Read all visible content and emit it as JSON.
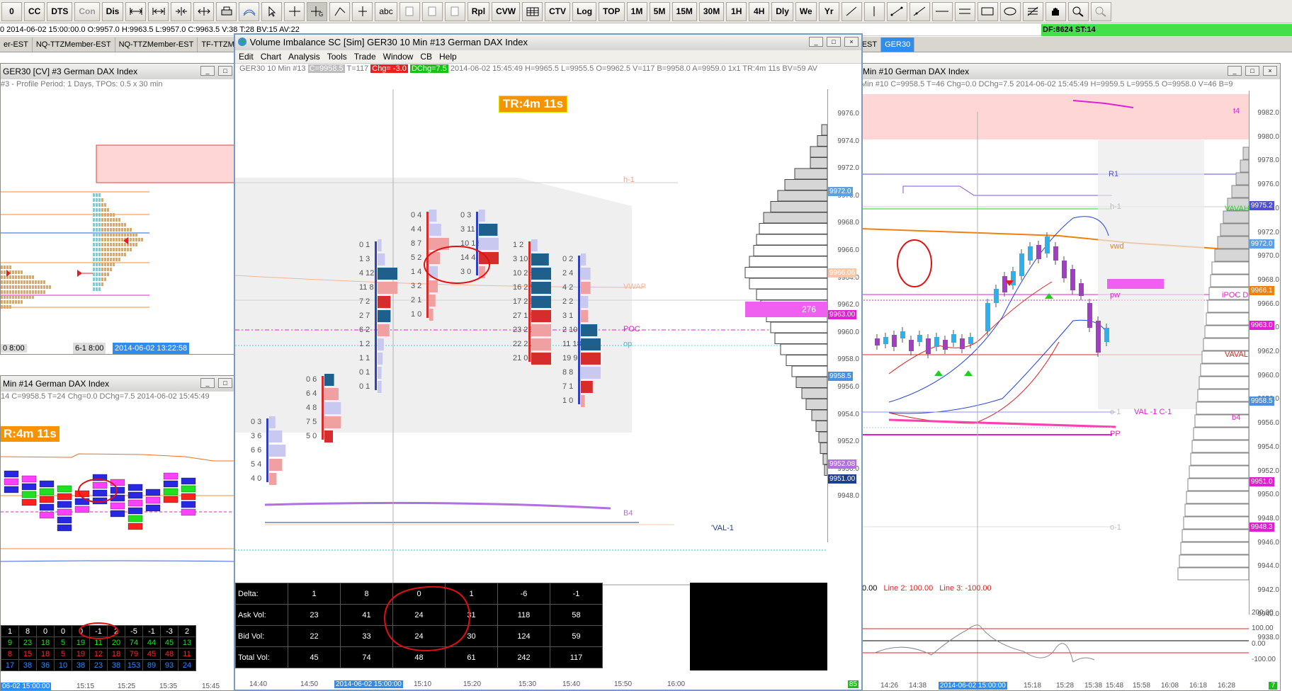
{
  "toolbar": {
    "buttons": [
      "CC",
      "DTS",
      "Con",
      "Dis",
      "Rpl",
      "CVW",
      "CTV",
      "Log",
      "TOP",
      "1M",
      "5M",
      "15M",
      "30M",
      "1H",
      "4H",
      "Dly",
      "We",
      "Yr"
    ]
  },
  "status": {
    "ohlc": "0  2014-06-02 15:00:00.0  O:9957.0  H:9963.5  L:9957.0  C:9963.5  V:38  T:28  BV:15  AV:22",
    "df": "DF:8624  ST:14"
  },
  "tabs": [
    "er-EST",
    "NQ-TTZMember-EST",
    "NQ-TTZMember-EST",
    "TF-TTZMember-EST",
    "mber-EST",
    "GER30"
  ],
  "left_top": {
    "title": "GER30 [CV]  #3  German DAX Index",
    "info": "#3 - Profile Period: 1 Days, TPOs: 0.5 x 30 min",
    "date1": "0 8:00",
    "date2": "6-1 8:00",
    "date3": "2014-06-02 13:22:58"
  },
  "left_bottom": {
    "title": "Min  #14  German DAX Index",
    "info": "14  C=9958.5  T=24  Chg=0.0  DChg=7.5  2014-06-02 15:45:49",
    "banner": "R:4m 11s",
    "rows": [
      [
        "1",
        "8",
        "0",
        "0",
        "0",
        "-1",
        "2",
        "-5",
        "-1",
        "-3",
        "2"
      ],
      [
        "9",
        "23",
        "18",
        "5",
        "19",
        "11",
        "20",
        "74",
        "44",
        "45",
        "13"
      ],
      [
        "8",
        "15",
        "18",
        "5",
        "19",
        "12",
        "18",
        "79",
        "45",
        "48",
        "11"
      ],
      [
        "17",
        "38",
        "36",
        "10",
        "38",
        "23",
        "38",
        "153",
        "89",
        "93",
        "24"
      ]
    ],
    "times": [
      "06-02 15:00:00",
      "15:15",
      "15:25",
      "15:35",
      "15:45"
    ]
  },
  "main": {
    "title": "Volume Imbalance  SC [Sim] GER30  10 Min   #13  German DAX Index",
    "menu": [
      "Edit",
      "Chart",
      "Analysis",
      "Tools",
      "Trade",
      "Window",
      "CB",
      "Help"
    ],
    "info_sym": "GER30  10 Min  #13",
    "info_c": "C=9958.5",
    "info_t": "T=117",
    "info_chg": "Chg= -3.0",
    "info_dchg": "DChg=7.5",
    "info_rest": "2014-06-02 15:45:49  H=9965.5  L=9955.5  O=9962.5  V=117  B=9958.0  A=9959.0  1x1  TR:4m 11s  BV=59  AV",
    "timer": "TR:4m 11s",
    "labels": {
      "h1": "h-1",
      "vwap": "VWAP",
      "poc": "POC",
      "op": "op",
      "b4": "B4",
      "val1": "'VAL-1"
    },
    "profile_poc": "276",
    "y_ticks": [
      "9976.0",
      "9974.0",
      "9972.0",
      "9970.0",
      "9968.0",
      "9966.0",
      "9964.0",
      "9962.0",
      "9960.0",
      "9958.0",
      "9956.0",
      "9954.0",
      "9952.0",
      "9950.0",
      "9948.0"
    ],
    "price_tags": [
      {
        "label": "9972.0",
        "color": "#5aa0e8"
      },
      {
        "label": "9966.06",
        "color": "#f5c9a8"
      },
      {
        "label": "9963.00",
        "color": "#e020d0"
      },
      {
        "label": "9958.5",
        "color": "#4a90e0"
      },
      {
        "label": "9952.08",
        "color": "#b070e0"
      },
      {
        "label": "9951.00",
        "color": "#1f3f8c"
      }
    ],
    "delta_table": {
      "labels": [
        "Delta:",
        "Ask Vol:",
        "Bid Vol:",
        "Total Vol:"
      ],
      "delta": [
        "1",
        "8",
        "0",
        "1",
        "-6",
        "-1"
      ],
      "ask": [
        "23",
        "41",
        "24",
        "31",
        "118",
        "58"
      ],
      "bid": [
        "22",
        "33",
        "24",
        "30",
        "124",
        "59"
      ],
      "total": [
        "45",
        "74",
        "48",
        "61",
        "242",
        "117"
      ]
    },
    "x_labels": [
      "14:40",
      "14:50",
      "2014-06-02 15:00:00",
      "15:10",
      "15:20",
      "15:30",
      "15:40",
      "15:50",
      "16:00"
    ],
    "footprint": [
      [
        "0 3",
        "3 6",
        "6 6",
        "5 4",
        "4 0"
      ],
      [
        "0 6",
        "6 4",
        "4 8",
        "7 5",
        "5 0"
      ],
      [
        "0 1",
        "1 3",
        "4 12",
        "11 8",
        "7 2",
        "2 7",
        "6 2",
        "1 2",
        "1 1",
        "0 1",
        "0 1"
      ],
      [
        "0 4",
        "4 4",
        "8 7",
        "5 2",
        "1 4",
        "3 2",
        "2 1",
        "1 0"
      ],
      [
        "0 3",
        "3 11",
        "10 13",
        "14 4",
        "3 0"
      ],
      [
        "1 2",
        "3 10",
        "10 25",
        "16 27",
        "17 22",
        "27 16",
        "23 22",
        "22 21",
        "21 0"
      ],
      [
        "0 2",
        "2 4",
        "4 2",
        "2 2",
        "3 1",
        "2 10",
        "11 18",
        "19 9",
        "8 8",
        "7 1",
        "1 0"
      ]
    ]
  },
  "right": {
    "title": "Min  #10  German DAX Index",
    "info": "Min  #10  C=9958.5  T=46  Chg=0.0  DChg=7.5  2014-06-02 15:45:49  H=9959.5  L=9955.5  O=9958.0  V=46  B=9",
    "labels": {
      "r1": "R1",
      "h1": "h-1",
      "vah": "VAVAH",
      "vwd": "vwd",
      "poc_d": "iPOC D",
      "pw": "pw",
      "val": "VAVAL",
      "c1": "c-1",
      "val1": "VAL -1  C-1",
      "b4": "b4",
      "pp": "PP",
      "o1": "o-1",
      "t4": "t4"
    },
    "y_ticks": [
      "9982.0",
      "9980.0",
      "9978.0",
      "9976.0",
      "9974.0",
      "9972.0",
      "9970.0",
      "9968.0",
      "9966.0",
      "9964.0",
      "9962.0",
      "9960.0",
      "9958.0",
      "9956.0",
      "9954.0",
      "9952.0",
      "9950.0",
      "9948.0",
      "9946.0",
      "9944.0",
      "9942.0",
      "9940.0",
      "9938.0"
    ],
    "price_tags": [
      {
        "label": "9975.2",
        "color": "#5050d0"
      },
      {
        "label": "9972.0",
        "color": "#5aa0e8"
      },
      {
        "label": "9966.1",
        "color": "#f08010"
      },
      {
        "label": "9963.0",
        "color": "#e020d0"
      },
      {
        "label": "9958.5",
        "color": "#4a90e0"
      },
      {
        "label": "9951.0",
        "color": "#e020d0"
      },
      {
        "label": "9948.3",
        "color": "#e020d0"
      }
    ],
    "osc": {
      "line1": "0.00",
      "line2": "Line 2: 100.00",
      "line3": "Line 3: -100.00",
      "ticks": [
        "200.00",
        "100.00",
        "0.00",
        "-100.00"
      ]
    },
    "x_labels": [
      "14:26",
      "14:38",
      "2014-06-02 15:00:00",
      "15:18",
      "15:28",
      "15:38",
      "15:48",
      "15:58",
      "16:08",
      "16:18",
      "16:28"
    ],
    "corner": "7"
  }
}
